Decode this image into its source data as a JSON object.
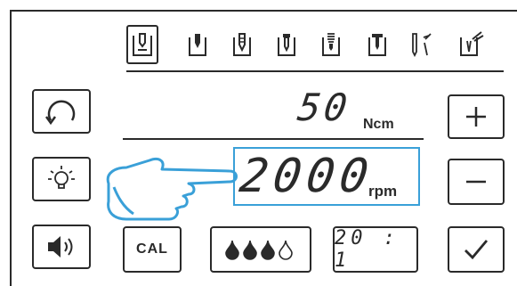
{
  "torque": {
    "value": "50",
    "unit": "Ncm"
  },
  "speed": {
    "value": "2000",
    "unit": "rpm"
  },
  "buttons": {
    "calibrate_label": "CAL",
    "ratio_label": "20 : 1"
  },
  "tools": [
    "tool-1-icon",
    "tool-2-icon",
    "tool-3-icon",
    "tool-4-icon",
    "tool-5-icon",
    "tool-6-icon",
    "tool-7-icon",
    "tool-8-icon"
  ],
  "coolant_level": {
    "filled_drops": 3,
    "total_drops": 4
  },
  "colors": {
    "ink": "#2a2a2a",
    "highlight": "#3aa0d8"
  }
}
